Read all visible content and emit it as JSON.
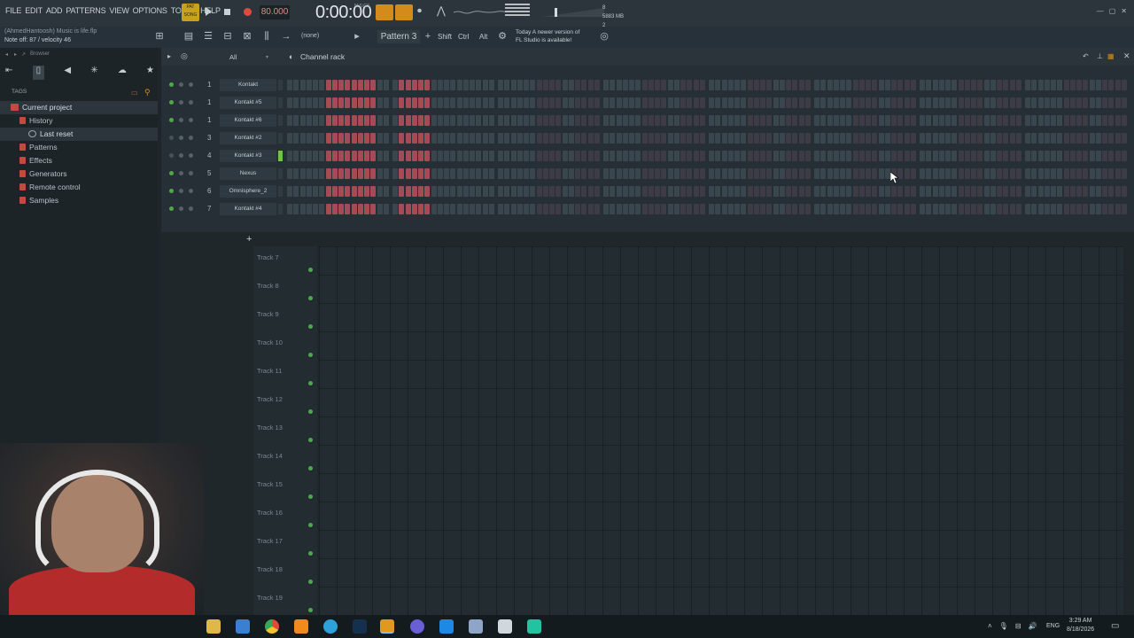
{
  "menu": [
    "FILE",
    "EDIT",
    "ADD",
    "PATTERNS",
    "VIEW",
    "OPTIONS",
    "TOOLS",
    "HELP"
  ],
  "transport": {
    "pat_song": "PAT\nSONG",
    "tempo": "80.000",
    "time": "0:00:00",
    "time_unit": "M:S:CS",
    "cpu": "8",
    "memory": "5883 MB",
    "poly": "2"
  },
  "project": {
    "name_line": "(AhmedHantoosh) Music is life.flp",
    "note_line": "Note off: 87 / velocity 46"
  },
  "toolbar": {
    "none_label": "(none)",
    "pattern": "Pattern 3",
    "shift": "Shift",
    "ctrl": "Ctrl",
    "alt": "Alt",
    "news_line1": "Today  A newer version of",
    "news_line2": "FL Studio is available!"
  },
  "browser": {
    "header": "Browser",
    "tags_label": "TAGS",
    "items": [
      {
        "label": "Current project",
        "indent": 0,
        "selected": true
      },
      {
        "label": "History",
        "indent": 1,
        "selected": false
      },
      {
        "label": "Last reset",
        "indent": 2,
        "selected": true
      },
      {
        "label": "Patterns",
        "indent": 1,
        "selected": false
      },
      {
        "label": "Effects",
        "indent": 1,
        "selected": false
      },
      {
        "label": "Generators",
        "indent": 1,
        "selected": false
      },
      {
        "label": "Remote control",
        "indent": 1,
        "selected": false
      },
      {
        "label": "Samples",
        "indent": 1,
        "selected": false
      }
    ]
  },
  "rack": {
    "filter": "All",
    "title": "Channel rack",
    "channels": [
      {
        "num": "1",
        "name": "Kontakt",
        "on": true,
        "active": false
      },
      {
        "num": "1",
        "name": "Kontakt #5",
        "on": true,
        "active": false
      },
      {
        "num": "1",
        "name": "Kontakt #6",
        "on": true,
        "active": false
      },
      {
        "num": "3",
        "name": "Kontakt #2",
        "on": false,
        "active": false
      },
      {
        "num": "4",
        "name": "Kontakt #3",
        "on": false,
        "active": true
      },
      {
        "num": "5",
        "name": "Nexus",
        "on": true,
        "active": false
      },
      {
        "num": "6",
        "name": "Omnisphere_2",
        "on": true,
        "active": false
      },
      {
        "num": "7",
        "name": "Kontakt #4",
        "on": true,
        "active": false
      }
    ]
  },
  "playlist": {
    "tracks": [
      "Track 7",
      "Track 8",
      "Track 9",
      "Track 10",
      "Track 11",
      "Track 12",
      "Track 13",
      "Track 14",
      "Track 15",
      "Track 16",
      "Track 17",
      "Track 18",
      "Track 19"
    ]
  },
  "taskbar": {
    "lang": "ENG",
    "time": "3:29 AM",
    "date": "8/18/2026"
  },
  "colors": {
    "accent_orange": "#d58a1c",
    "step_red": "#a44b55",
    "led_green": "#4fa84a",
    "record_red": "#e04a3c"
  }
}
